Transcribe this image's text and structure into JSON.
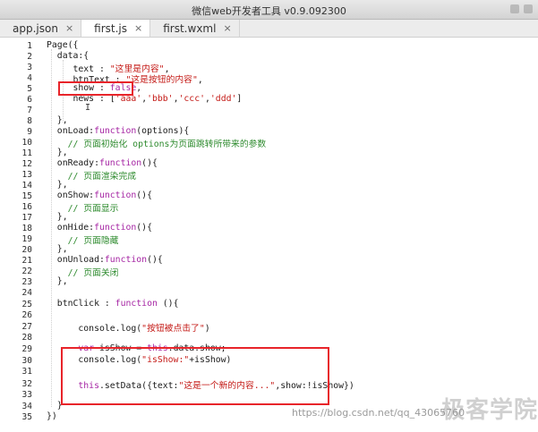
{
  "window": {
    "title": "微信web开发者工具 v0.9.092300"
  },
  "tabs": [
    {
      "label": "app.json",
      "close": "×"
    },
    {
      "label": "first.js",
      "close": "×"
    },
    {
      "label": "first.wxml",
      "close": "×"
    }
  ],
  "line_numbers": [
    "1",
    "2",
    "3",
    "4",
    "5",
    "6",
    "7",
    "8",
    "9",
    "10",
    "11",
    "12",
    "13",
    "14",
    "15",
    "16",
    "17",
    "18",
    "19",
    "20",
    "21",
    "22",
    "23",
    "24",
    "25",
    "26",
    "27",
    "28",
    "29",
    "30",
    "31",
    "32",
    "33",
    "34",
    "35"
  ],
  "code": {
    "l1": "Page({",
    "l2": "  data:{",
    "l3a": "     text : ",
    "l3b": "\"这里是内容\"",
    "l3c": ",",
    "l4a": "     btnText : ",
    "l4b": "\"这是按钮的内容\"",
    "l4c": ",",
    "l5a": "     show : ",
    "l5b": "false",
    "l5c": ",",
    "l6a": "     news : [",
    "l6b": "'aaa'",
    "l6c": ",",
    "l6d": "'bbb'",
    "l6e": ",",
    "l6f": "'ccc'",
    "l6g": ",",
    "l6h": "'ddd'",
    "l6i": "]",
    "l8": "  },",
    "l9a": "  onLoad:",
    "l9b": "function",
    "l9c": "(options){",
    "l10": "    // 页面初始化 options为页面跳转所带来的参数",
    "l11": "  },",
    "l12a": "  onReady:",
    "l12b": "function",
    "l12c": "(){",
    "l13": "    // 页面渲染完成",
    "l14": "  },",
    "l15a": "  onShow:",
    "l15b": "function",
    "l15c": "(){",
    "l16": "    // 页面显示",
    "l17": "  },",
    "l18a": "  onHide:",
    "l18b": "function",
    "l18c": "(){",
    "l19": "    // 页面隐藏",
    "l20": "  },",
    "l21a": "  onUnload:",
    "l21b": "function",
    "l21c": "(){",
    "l22": "    // 页面关闭",
    "l23": "  },",
    "l25a": "  btnClick : ",
    "l25b": "function",
    "l25c": " (){",
    "l27a": "      console.log(",
    "l27b": "\"按钮被点击了\"",
    "l27c": ")",
    "l29a": "      ",
    "l29b": "var",
    "l29c": " isShow = ",
    "l29d": "this",
    "l29e": ".data.show;",
    "l30a": "      console.log(",
    "l30b": "\"isShow:\"",
    "l30c": "+isShow)",
    "l32a": "      ",
    "l32b": "this",
    "l32c": ".setData({text:",
    "l32d": "\"这是一个新的内容...\"",
    "l32e": ",show:!isShow})",
    "l34": "  }",
    "l35": "})"
  },
  "watermark": {
    "text": "极客学院",
    "url": "https://blog.csdn.net/qq_43065760"
  },
  "colors": {
    "keyword": "#a626a4",
    "string": "#c41a16",
    "comment": "#2e8b2e",
    "highlight": "#e8242a"
  }
}
